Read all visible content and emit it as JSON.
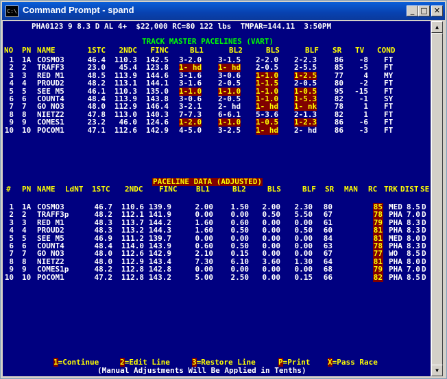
{
  "window": {
    "icon_label": "C:\\",
    "title": "Command Prompt - spand",
    "minimize": "_",
    "maximize": "□",
    "close": "✕"
  },
  "header": {
    "race_line": "PHA0123 9 8.3 D AL 4+  $22,000 RC=80 122 lbs  TMPAR=144.11  3:50PM"
  },
  "track_master": {
    "title": "TRACK MASTER PACELINES (VART)",
    "columns": [
      "NO",
      "PN",
      "NAME",
      "1STC",
      "2NDC",
      "FINC",
      "BL1",
      "BL2",
      "BLS",
      "BLF",
      "SR",
      "TV",
      "COND"
    ],
    "rows": [
      {
        "no": "1",
        "pn": "1A",
        "name": "COSMO3",
        "c1": "46.4",
        "c2": "110.3",
        "fin": "142.5",
        "bl1": "3-2.0",
        "bl2": "3-1.5",
        "bls": "2-2.0",
        "blf": "2-2.3",
        "sr": "86",
        "tv": "-8",
        "cond": "FT",
        "hl": []
      },
      {
        "no": "2",
        "pn": "2",
        "name": "TRAFF3",
        "c1": "23.0",
        "c2": "45.4",
        "fin": "123.8",
        "bl1": "1- hd",
        "bl2": "1- hd",
        "bls": "2-0.5",
        "blf": "2-5.5",
        "sr": "85",
        "tv": "-5",
        "cond": "FT",
        "hl": [
          "bl1",
          "bl2"
        ]
      },
      {
        "no": "3",
        "pn": "3",
        "name": "RED M1",
        "c1": "48.5",
        "c2": "113.9",
        "fin": "144.6",
        "bl1": "3-1.6",
        "bl2": "3-0.6",
        "bls": "1-1.0",
        "blf": "1-2.5",
        "sr": "77",
        "tv": "4",
        "cond": "MY",
        "hl": [
          "bls",
          "blf"
        ]
      },
      {
        "no": "4",
        "pn": "4",
        "name": "PROUD2",
        "c1": "48.2",
        "c2": "113.1",
        "fin": "144.1",
        "bl1": "3-1.6",
        "bl2": "2-0.5",
        "bls": "1-1.5",
        "blf": "2-0.5",
        "sr": "80",
        "tv": "-2",
        "cond": "FT",
        "hl": [
          "bls"
        ]
      },
      {
        "no": "5",
        "pn": "5",
        "name": "SEE M5",
        "c1": "46.1",
        "c2": "110.3",
        "fin": "135.0",
        "bl1": "1-1.0",
        "bl2": "1-1.0",
        "bls": "1-1.0",
        "blf": "1-0.5",
        "sr": "95",
        "tv": "-15",
        "cond": "FT",
        "hl": [
          "bl1",
          "bl2",
          "bls",
          "blf"
        ]
      },
      {
        "no": "6",
        "pn": "6",
        "name": "COUNT4",
        "c1": "48.4",
        "c2": "113.9",
        "fin": "143.8",
        "bl1": "3-0.6",
        "bl2": "2-0.5",
        "bls": "1-1.0",
        "blf": "1-5.3",
        "sr": "82",
        "tv": "-1",
        "cond": "SY",
        "hl": [
          "bls",
          "blf"
        ]
      },
      {
        "no": "7",
        "pn": "7",
        "name": "GO NO3",
        "c1": "48.0",
        "c2": "112.9",
        "fin": "146.4",
        "bl1": "3-2.1",
        "bl2": "2- hd",
        "bls": "1- hd",
        "blf": "1- nk",
        "sr": "78",
        "tv": "1",
        "cond": "FT",
        "hl": [
          "bls",
          "blf"
        ]
      },
      {
        "no": "8",
        "pn": "8",
        "name": "NIETZ2",
        "c1": "47.8",
        "c2": "113.0",
        "fin": "140.3",
        "bl1": "7-7.3",
        "bl2": "6-6.1",
        "bls": "5-3.6",
        "blf": "2-1.3",
        "sr": "82",
        "tv": "1",
        "cond": "FT",
        "hl": []
      },
      {
        "no": "9",
        "pn": "9",
        "name": "COMES1",
        "c1": "23.2",
        "c2": "46.0",
        "fin": "124.6",
        "bl1": "1-2.0",
        "bl2": "1-1.0",
        "bls": "1-0.5",
        "blf": "1-2.3",
        "sr": "86",
        "tv": "-6",
        "cond": "FT",
        "hl": [
          "bl1",
          "bl2",
          "bls",
          "blf"
        ]
      },
      {
        "no": "10",
        "pn": "10",
        "name": "POCOM1",
        "c1": "47.1",
        "c2": "112.6",
        "fin": "142.9",
        "bl1": "4-5.0",
        "bl2": "3-2.5",
        "bls": "1- hd",
        "blf": "2- hd",
        "sr": "86",
        "tv": "-3",
        "cond": "FT",
        "hl": [
          "bls"
        ]
      }
    ]
  },
  "paceline": {
    "title": "PACELINE DATA (ADJUSTED)",
    "columns": [
      "#",
      "PN",
      "NAME",
      "LdNT",
      "1STC",
      "2NDC",
      "FINC",
      "BL1",
      "BL2",
      "BLS",
      "BLF",
      "SR",
      "MAN",
      "RC",
      "TRK",
      "DIST",
      "SE"
    ],
    "rows": [
      {
        "no": "1",
        "pn": "1A",
        "name": "COSMO3",
        "ldnt": "",
        "c1": "46.7",
        "c2": "110.6",
        "fin": "139.9",
        "bl1": "2.00",
        "bl2": "1.50",
        "bls": "2.00",
        "blf": "2.30",
        "sr": "80",
        "man": "",
        "rc": "85",
        "trk": "MED",
        "dist": "8.5",
        "se": "D"
      },
      {
        "no": "2",
        "pn": "2",
        "name": "TRAFF3p",
        "ldnt": "",
        "c1": "48.2",
        "c2": "112.1",
        "fin": "141.9",
        "bl1": "0.00",
        "bl2": "0.00",
        "bls": "0.50",
        "blf": "5.50",
        "sr": "67",
        "man": "",
        "rc": "78",
        "trk": "PHA",
        "dist": "7.0",
        "se": "D"
      },
      {
        "no": "3",
        "pn": "3",
        "name": "RED M1",
        "ldnt": "",
        "c1": "48.3",
        "c2": "113.7",
        "fin": "144.2",
        "bl1": "1.60",
        "bl2": "0.60",
        "bls": "0.00",
        "blf": "0.00",
        "sr": "61",
        "man": "",
        "rc": "79",
        "trk": "PHA",
        "dist": "8.3",
        "se": "D"
      },
      {
        "no": "4",
        "pn": "4",
        "name": "PROUD2",
        "ldnt": "",
        "c1": "48.3",
        "c2": "113.2",
        "fin": "144.3",
        "bl1": "1.60",
        "bl2": "0.50",
        "bls": "0.00",
        "blf": "0.50",
        "sr": "60",
        "man": "",
        "rc": "81",
        "trk": "PHA",
        "dist": "8.3",
        "se": "D"
      },
      {
        "no": "5",
        "pn": "5",
        "name": "SEE M5",
        "ldnt": "",
        "c1": "46.9",
        "c2": "111.2",
        "fin": "139.7",
        "bl1": "0.00",
        "bl2": "0.00",
        "bls": "0.00",
        "blf": "0.00",
        "sr": "84",
        "man": "",
        "rc": "81",
        "trk": "MED",
        "dist": "8.0",
        "se": "D"
      },
      {
        "no": "6",
        "pn": "6",
        "name": "COUNT4",
        "ldnt": "",
        "c1": "48.4",
        "c2": "114.0",
        "fin": "143.9",
        "bl1": "0.60",
        "bl2": "0.50",
        "bls": "0.00",
        "blf": "0.00",
        "sr": "63",
        "man": "",
        "rc": "78",
        "trk": "PHA",
        "dist": "8.3",
        "se": "D"
      },
      {
        "no": "7",
        "pn": "7",
        "name": "GO NO3",
        "ldnt": "",
        "c1": "48.0",
        "c2": "112.6",
        "fin": "142.9",
        "bl1": "2.10",
        "bl2": "0.15",
        "bls": "0.00",
        "blf": "0.00",
        "sr": "67",
        "man": "",
        "rc": "77",
        "trk": "WO",
        "dist": "8.5",
        "se": "D"
      },
      {
        "no": "8",
        "pn": "8",
        "name": "NIETZ2",
        "ldnt": "",
        "c1": "48.0",
        "c2": "112.9",
        "fin": "143.4",
        "bl1": "7.30",
        "bl2": "6.10",
        "bls": "3.60",
        "blf": "1.30",
        "sr": "64",
        "man": "",
        "rc": "81",
        "trk": "PHA",
        "dist": "8.0",
        "se": "D"
      },
      {
        "no": "9",
        "pn": "9",
        "name": "COMES1p",
        "ldnt": "",
        "c1": "48.2",
        "c2": "112.8",
        "fin": "142.8",
        "bl1": "0.00",
        "bl2": "0.00",
        "bls": "0.00",
        "blf": "0.00",
        "sr": "68",
        "man": "",
        "rc": "79",
        "trk": "PHA",
        "dist": "7.0",
        "se": "D"
      },
      {
        "no": "10",
        "pn": "10",
        "name": "POCOM1",
        "ldnt": "",
        "c1": "47.2",
        "c2": "112.8",
        "fin": "143.2",
        "bl1": "5.00",
        "bl2": "2.50",
        "bls": "0.00",
        "blf": "0.15",
        "sr": "66",
        "man": "",
        "rc": "82",
        "trk": "PHA",
        "dist": "8.5",
        "se": "D"
      }
    ]
  },
  "footer": {
    "commands": [
      {
        "key": "1",
        "label": "=Continue"
      },
      {
        "key": "2",
        "label": "=Edit Line"
      },
      {
        "key": "3",
        "label": "=Restore Line"
      },
      {
        "key": "P",
        "label": "=Print"
      },
      {
        "key": "X",
        "label": "=Pass Race"
      }
    ],
    "note": "(Manual Adjustments Will Be Applied in Tenths)"
  },
  "colors": {
    "console_bg": "#000080",
    "title_bar": "#0a4fc8",
    "text_white": "#ffffff",
    "text_yellow": "#ffff00",
    "text_green": "#00ff00",
    "highlight_bg": "#800000"
  }
}
